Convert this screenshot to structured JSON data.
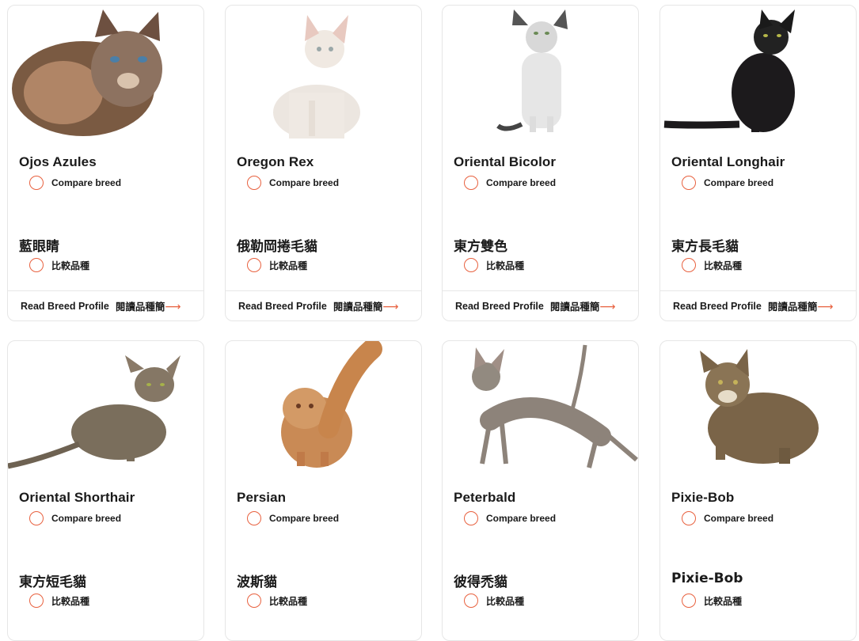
{
  "compare_label_en": "Compare breed",
  "compare_label_zh": "比較品種",
  "profile_label_en": "Read Breed Profile",
  "profile_label_zh": "閱讀品種簡",
  "accent_color": "#e8613f",
  "breeds": [
    {
      "name_en": "Ojos Azules",
      "name_zh": "藍眼睛"
    },
    {
      "name_en": "Oregon Rex",
      "name_zh": "俄勒岡捲毛貓"
    },
    {
      "name_en": "Oriental Bicolor",
      "name_zh": "東方雙色"
    },
    {
      "name_en": "Oriental Longhair",
      "name_zh": "東方長毛貓"
    },
    {
      "name_en": "Oriental Shorthair",
      "name_zh": "東方短毛貓"
    },
    {
      "name_en": "Persian",
      "name_zh": "波斯貓"
    },
    {
      "name_en": "Peterbald",
      "name_zh": "彼得禿貓"
    },
    {
      "name_en": "Pixie-Bob",
      "name_zh": "Pixie-Bob"
    }
  ]
}
